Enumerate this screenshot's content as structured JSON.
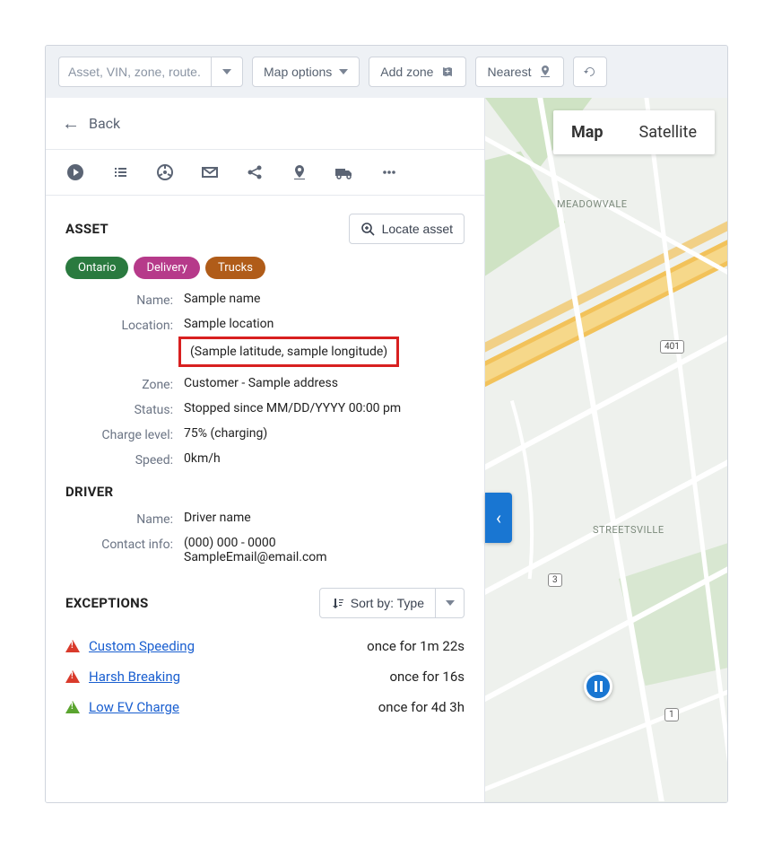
{
  "toolbar": {
    "search_placeholder": "Asset, VIN, zone, route...",
    "map_options": "Map options",
    "add_zone": "Add zone",
    "nearest": "Nearest"
  },
  "back_label": "Back",
  "asset": {
    "title": "ASSET",
    "locate_label": "Locate asset",
    "tags": {
      "ontario": "Ontario",
      "delivery": "Delivery",
      "trucks": "Trucks"
    },
    "labels": {
      "name": "Name:",
      "location": "Location:",
      "zone": "Zone:",
      "status": "Status:",
      "charge": "Charge level:",
      "speed": "Speed:"
    },
    "values": {
      "name": "Sample name",
      "location": "Sample location",
      "coords": "(Sample latitude, sample longitude)",
      "zone": "Customer - Sample address",
      "status": "Stopped since MM/DD/YYYY 00:00 pm",
      "charge": "75% (charging)",
      "speed": "0km/h"
    }
  },
  "driver": {
    "title": "DRIVER",
    "labels": {
      "name": "Name:",
      "contact": "Contact info:"
    },
    "values": {
      "name": "Driver name",
      "phone": "(000) 000 - 0000",
      "email": "SampleEmail@email.com"
    }
  },
  "exceptions": {
    "title": "EXCEPTIONS",
    "sort_label": "Sort by: Type",
    "items": [
      {
        "name": "Custom Speeding",
        "duration": "once for 1m 22s",
        "severity": "red"
      },
      {
        "name": "Harsh Breaking",
        "duration": "once for 16s",
        "severity": "red"
      },
      {
        "name": "Low EV Charge",
        "duration": "once for 4d 3h",
        "severity": "green"
      }
    ]
  },
  "map": {
    "tabs": {
      "map": "Map",
      "satellite": "Satellite"
    },
    "labels": {
      "meadowvale": "MEADOWVALE",
      "streetsville": "STREETSVILLE"
    },
    "shields": {
      "hw401": "401",
      "r3": "3",
      "r1": "1"
    }
  }
}
